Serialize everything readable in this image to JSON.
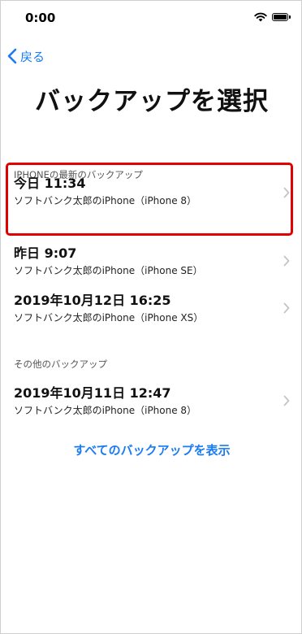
{
  "status": {
    "time": "0:00"
  },
  "nav": {
    "back_label": "戻る"
  },
  "title": "バックアップを選択",
  "sections": [
    {
      "header": "IPHONEの最新のバックアップ"
    },
    {
      "header": "その他のバックアップ"
    }
  ],
  "rows": [
    {
      "title": "今日 11:34",
      "subtitle": "ソフトバンク太郎のiPhone（iPhone 8）"
    },
    {
      "title": "昨日 9:07",
      "subtitle": "ソフトバンク太郎のiPhone（iPhone SE）"
    },
    {
      "title": "2019年10月12日 16:25",
      "subtitle": "ソフトバンク太郎のiPhone（iPhone XS）"
    },
    {
      "title": "2019年10月11日 12:47",
      "subtitle": "ソフトバンク太郎のiPhone（iPhone 8）"
    }
  ],
  "show_all_label": "すべてのバックアップを表示",
  "colors": {
    "accent": "#1a7cf2",
    "highlight": "#e00000"
  }
}
